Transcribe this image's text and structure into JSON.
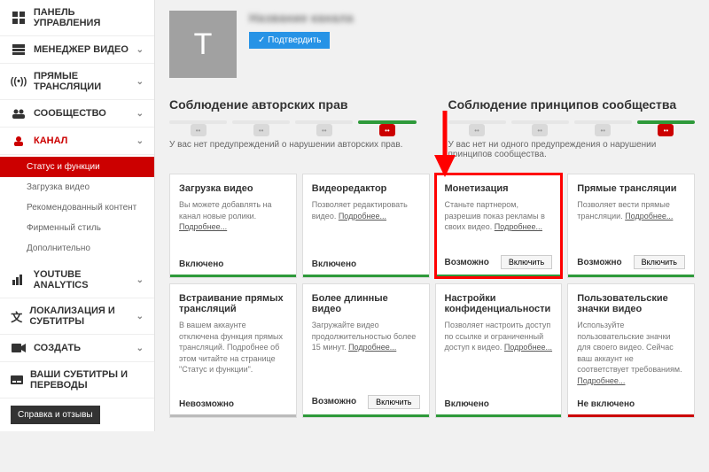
{
  "sidebar": {
    "items": [
      {
        "label": "ПАНЕЛЬ УПРАВЛЕНИЯ",
        "icon": "dashboard"
      },
      {
        "label": "МЕНЕДЖЕР ВИДЕО",
        "icon": "video-manager",
        "expandable": true
      },
      {
        "label": "ПРЯМЫЕ ТРАНСЛЯЦИИ",
        "icon": "live",
        "expandable": true
      },
      {
        "label": "СООБЩЕСТВО",
        "icon": "community",
        "expandable": true
      },
      {
        "label": "КАНАЛ",
        "icon": "channel",
        "expandable": true,
        "active": true
      },
      {
        "label": "YOUTUBE ANALYTICS",
        "icon": "analytics",
        "expandable": true
      },
      {
        "label": "ЛОКАЛИЗАЦИЯ И СУБТИТРЫ",
        "icon": "translate",
        "expandable": true
      },
      {
        "label": "СОЗДАТЬ",
        "icon": "create",
        "expandable": true
      },
      {
        "label": "ВАШИ СУБТИТРЫ И ПЕРЕВОДЫ",
        "icon": "subtitles"
      }
    ],
    "channel_sub": [
      "Статус и функции",
      "Загрузка видео",
      "Рекомендованный контент",
      "Фирменный стиль",
      "Дополнительно"
    ],
    "help": "Справка и отзывы"
  },
  "header": {
    "avatar_letter": "Т",
    "channel_name": "Название канала",
    "verify": "Подтвердить"
  },
  "compliance": {
    "copyright": {
      "title": "Соблюдение авторских прав",
      "text": "У вас нет предупреждений о нарушении авторских прав."
    },
    "community": {
      "title": "Соблюдение принципов сообщества",
      "text": "У вас нет ни одного предупреждения о нарушении принципов сообщества."
    }
  },
  "more_label": "Подробнее...",
  "cards": [
    {
      "title": "Загрузка видео",
      "desc": "Вы можете добавлять на канал новые ролики. ",
      "status": "Включено",
      "bar": "green"
    },
    {
      "title": "Видеоредактор",
      "desc": "Позволяет редактировать видео. ",
      "status": "Включено",
      "bar": "green"
    },
    {
      "title": "Монетизация",
      "desc": "Станьте партнером, разрешив показ рекламы в своих видео. ",
      "status": "Возможно",
      "button": "Включить",
      "bar": "green",
      "highlight": true
    },
    {
      "title": "Прямые трансляции",
      "desc": "Позволяет вести прямые трансляции. ",
      "status": "Возможно",
      "button": "Включить",
      "bar": "green"
    },
    {
      "title": "Встраивание прямых трансляций",
      "desc": "В вашем аккаунте отключена функция прямых трансляций. Подробнее об этом читайте на странице \"Статус и функции\".",
      "status": "Невозможно",
      "bar": "gray"
    },
    {
      "title": "Более длинные видео",
      "desc": "Загружайте видео продолжительностью более 15 минут. ",
      "status": "Возможно",
      "button": "Включить",
      "bar": "green"
    },
    {
      "title": "Настройки конфиденциальности",
      "desc": "Позволяет настроить доступ по ссылке и ограниченный доступ к видео. ",
      "status": "Включено",
      "bar": "green"
    },
    {
      "title": "Пользовательские значки видео",
      "desc": "Используйте пользовательские значки для своего видео. Сейчас ваш аккаунт не соответствует требованиям. ",
      "status": "Не включено",
      "bar": "red"
    }
  ]
}
